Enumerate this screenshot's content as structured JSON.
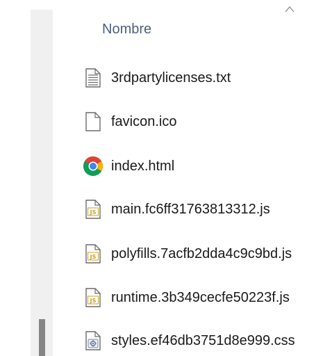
{
  "header": {
    "column_name": "Nombre",
    "sort_icon": "chevron-up-icon"
  },
  "files": [
    {
      "name": "3rdpartylicenses.txt",
      "icon": "text-file-icon"
    },
    {
      "name": "favicon.ico",
      "icon": "blank-file-icon"
    },
    {
      "name": "index.html",
      "icon": "chrome-icon"
    },
    {
      "name": "main.fc6ff31763813312.js",
      "icon": "js-file-icon"
    },
    {
      "name": "polyfills.7acfb2dda4c9c9bd.js",
      "icon": "js-file-icon"
    },
    {
      "name": "runtime.3b349cecfe50223f.js",
      "icon": "js-file-icon"
    },
    {
      "name": "styles.ef46db3751d8e999.css",
      "icon": "css-file-icon"
    }
  ],
  "colors": {
    "header_text": "#4c607a",
    "scroll_track": "#f0f0f0",
    "scroll_thumb": "#858585",
    "js_badge": "#c9a227"
  }
}
